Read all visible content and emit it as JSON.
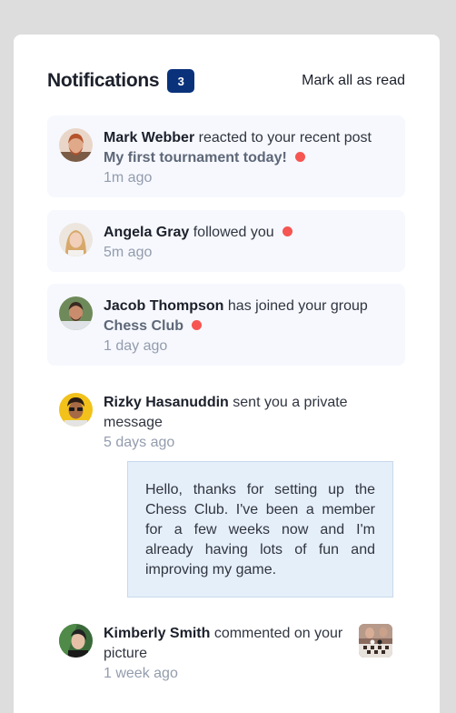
{
  "header": {
    "title": "Notifications",
    "count": "3",
    "mark_all": "Mark all as read"
  },
  "notifications": [
    {
      "name": "Mark Webber",
      "action": "reacted to your recent post",
      "target": "My first tournament today!",
      "time": "1m ago",
      "unread": true
    },
    {
      "name": "Angela Gray",
      "action": "followed you",
      "target": "",
      "time": "5m ago",
      "unread": true
    },
    {
      "name": "Jacob Thompson",
      "action": "has joined your group",
      "target": "Chess Club",
      "time": "1 day ago",
      "unread": true
    },
    {
      "name": "Rizky Hasanuddin",
      "action": "sent you a private message",
      "target": "",
      "time": "5 days ago",
      "unread": false,
      "message": "Hello, thanks for setting up the Chess Club. I've been a member for a few weeks now and I'm already having lots of fun and improving my game."
    },
    {
      "name": "Kimberly Smith",
      "action": "commented on your picture",
      "target": "",
      "time": "1 week ago",
      "unread": false
    }
  ],
  "colors": {
    "background": "#dddddd",
    "card": "#ffffff",
    "unread_bg": "#f6f8fd",
    "badge": "#0a327b",
    "dot": "#f65552",
    "message_bg": "#e5effa"
  },
  "icons": [
    "avatar-mark-webber",
    "avatar-angela-gray",
    "avatar-jacob-thompson",
    "avatar-rizky-hasanuddin",
    "avatar-kimberly-smith",
    "chess-picture-thumbnail",
    "unread-dot"
  ]
}
